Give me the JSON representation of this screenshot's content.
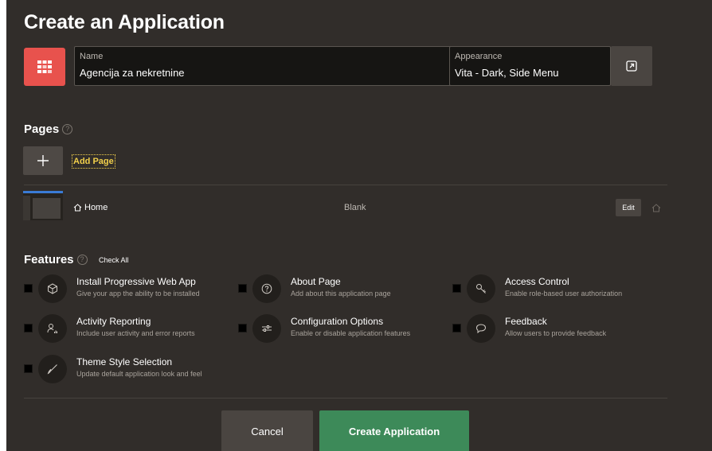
{
  "page": {
    "title": "Create an Application"
  },
  "app": {
    "icon": "grid-app-icon",
    "icon_color": "#e8524d",
    "name_label": "Name",
    "name_value": "Agencija za nekretnine",
    "appearance_label": "Appearance",
    "appearance_value": "Vita - Dark, Side Menu",
    "appearance_button_icon": "open-dialog-icon"
  },
  "pages": {
    "title": "Pages",
    "add_page_label": "Add Page",
    "rows": [
      {
        "name": "Home",
        "type": "Blank",
        "edit_label": "Edit",
        "is_home": true
      }
    ]
  },
  "features": {
    "title": "Features",
    "check_all_label": "Check All",
    "items": [
      {
        "title": "Install Progressive Web App",
        "description": "Give your app the ability to be installed",
        "icon": "cube-icon",
        "checked": false
      },
      {
        "title": "About Page",
        "description": "Add about this application page",
        "icon": "help-icon",
        "checked": false
      },
      {
        "title": "Access Control",
        "description": "Enable role-based user authorization",
        "icon": "key-icon",
        "checked": false
      },
      {
        "title": "Activity Reporting",
        "description": "Include user activity and error reports",
        "icon": "user-chart-icon",
        "checked": false
      },
      {
        "title": "Configuration Options",
        "description": "Enable or disable application features",
        "icon": "sliders-icon",
        "checked": false
      },
      {
        "title": "Feedback",
        "description": "Allow users to provide feedback",
        "icon": "speech-bubble-icon",
        "checked": false
      },
      {
        "title": "Theme Style Selection",
        "description": "Update default application look and feel",
        "icon": "brush-icon",
        "checked": false
      }
    ]
  },
  "footer": {
    "cancel_label": "Cancel",
    "create_label": "Create Application",
    "create_color": "#3d8a59"
  },
  "colors": {
    "background": "#312d2a",
    "accent_yellow": "#f2d04b",
    "input_background": "#161513"
  }
}
